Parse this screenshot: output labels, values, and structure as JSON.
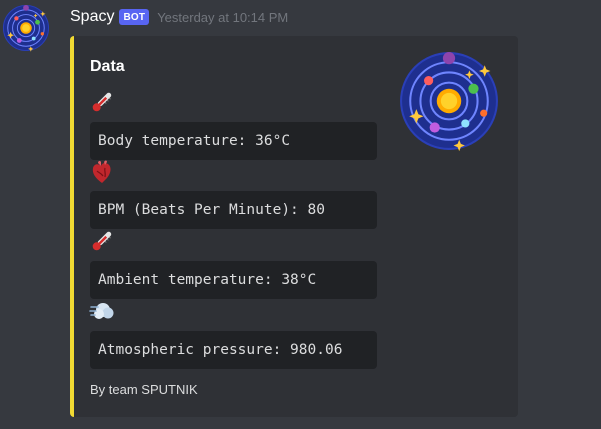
{
  "message": {
    "username": "Spacy",
    "bot_tag": "BOT",
    "timestamp": "Yesterday at 10:14 PM",
    "avatar_icon": "solar-system-icon"
  },
  "embed": {
    "accent_color": "#f1da33",
    "title": "Data",
    "thumbnail_icon": "solar-system-icon",
    "footer": "By team SPUTNIK",
    "fields": [
      {
        "icon": "thermometer-icon",
        "value": "Body temperature: 36°C"
      },
      {
        "icon": "anatomical-heart-icon",
        "value": "BPM (Beats Per Minute): 80"
      },
      {
        "icon": "thermometer-icon",
        "value": "Ambient temperature: 38°C"
      },
      {
        "icon": "wind-icon",
        "value": "Atmospheric pressure: 980.06"
      }
    ]
  },
  "colors": {
    "background": "#36393f",
    "embed_background": "#2f3136",
    "code_background": "#202225",
    "bot_tag": "#5865f2"
  }
}
